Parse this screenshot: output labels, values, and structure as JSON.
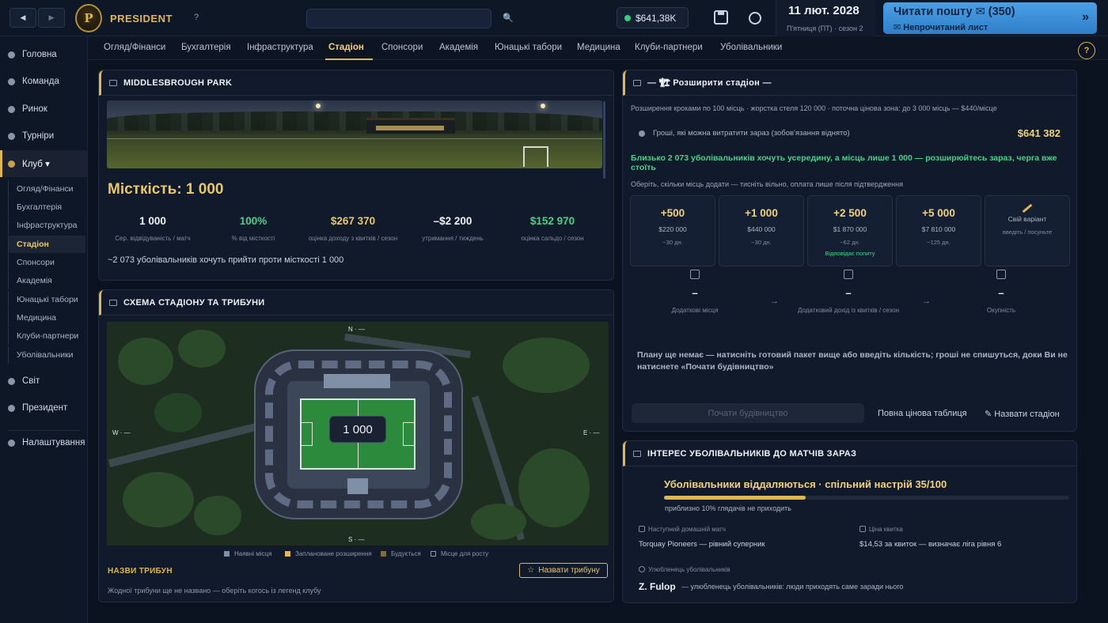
{
  "topbar": {
    "back": "◀",
    "forward": "▶",
    "logo": "P",
    "brand": "PRESIDENT",
    "help": "?",
    "search_icon": "🔍",
    "balance": "$641,38K",
    "date": "11 лют. 2028",
    "date_sub": "П'ятниця (ПТ) · сезон 2",
    "mail_main": "Читати пошту ✉ (350)",
    "mail_sub": "✉ Непрочитаний лист",
    "mail_arrow": "»"
  },
  "sidebar": {
    "items": [
      {
        "label": "Головна"
      },
      {
        "label": "Команда"
      },
      {
        "label": "Ринок"
      },
      {
        "label": "Турніри"
      },
      {
        "label": "Клуб ▾"
      },
      {
        "label": "Світ"
      },
      {
        "label": "Президент"
      },
      {
        "label": "Налаштування"
      }
    ],
    "club_sub": [
      "Огляд/Фінанси",
      "Бухгалтерія",
      "Інфраструктура",
      "Стадіон",
      "Спонсори",
      "Академія",
      "Юнацькі табори",
      "Медицина",
      "Клуби-партнери",
      "Уболівальники"
    ]
  },
  "tabs": [
    "Огляд/Фінанси",
    "Бухгалтерія",
    "Інфраструктура",
    "Стадіон",
    "Спонсори",
    "Академія",
    "Юнацькі табори",
    "Медицина",
    "Клуби-партнери",
    "Уболівальники"
  ],
  "help_circle": "?",
  "stadium": {
    "title": "MIDDLESBROUGH PARK",
    "capacity": "Місткість: 1 000",
    "stats": [
      {
        "value": "1 000",
        "label": "Сер. відвідуваність / матч"
      },
      {
        "value": "100%",
        "label": "% від місткості"
      },
      {
        "value": "$267 370",
        "label": "оцінка доходу з квитків / сезон"
      },
      {
        "value": "–$2 200",
        "label": "утримання / тиждень"
      },
      {
        "value": "$152 970",
        "label": "оцінка сальдо / сезон"
      }
    ],
    "fans_line": "~2 073 уболівальників хочуть прийти проти місткості 1 000"
  },
  "schema": {
    "title": "СХЕМА СТАДІОНУ ТА ТРИБУНИ",
    "capacity_badge": "1 000",
    "compass": {
      "n": "N · —",
      "s": "S · —",
      "w": "W · —",
      "e": "E · —"
    },
    "legend": [
      "Наявні місця",
      "Заплановане розширення",
      "Будується",
      "Місце для росту"
    ],
    "stands_title": "НАЗВИ ТРИБУН",
    "name_stand_btn": "Назвати трибуну",
    "no_stands": "Жодної трибуни ще не названо — оберіть когось із легенд клубу"
  },
  "expand": {
    "title": "— 🏗 Розширити стадіон —",
    "desc": "Розширення кроками по 100 місць · жорстка стеля 120 000 · поточна цінова зона: до 3 000 місць — $440/місце",
    "money_label": "Гроші, які можна витратити зараз (зобов'язання віднято)",
    "money_value": "$641 382",
    "green_msg": "Близько 2 073 уболівальників хочуть усередину, а місць лише 1 000 — розширюйтесь зараз, черга вже стоїть",
    "choose": "Оберіть, скільки місць додати — тисніть вільно, оплата лише після підтвердження",
    "packages": [
      {
        "title": "+500",
        "price": "$220 000",
        "days": "~30 дн.",
        "note": ""
      },
      {
        "title": "+1 000",
        "price": "$440 000",
        "days": "~30 дн.",
        "note": ""
      },
      {
        "title": "+2 500",
        "price": "$1 870 000",
        "days": "~62 дн.",
        "note": "Відповідає попиту"
      },
      {
        "title": "+5 000",
        "price": "$7 810 000",
        "days": "~125 дн.",
        "note": ""
      }
    ],
    "custom_title": "Свій варіант",
    "custom_sub": "введіть / посуньте",
    "summary": [
      {
        "value": "–",
        "label": "Додаткові місця"
      },
      {
        "value": "–",
        "label": "Додатковий дохід із квитків / сезон"
      },
      {
        "value": "–",
        "label": "Окупність"
      }
    ],
    "arrow": "→",
    "plan_msg": "Плану ще немає — натисніть готовий пакет вище або введіть кількість; гроші не спишуться, доки Ви не натиснете «Почати будівництво»",
    "build_btn": "Почати будівництво",
    "price_table": "Повна цінова таблиця",
    "name_stadium": "✎ Назвати стадіон"
  },
  "interest": {
    "title": "ІНТЕРЕС УБОЛІВАЛЬНИКІВ ДО МАТЧІВ ЗАРАЗ",
    "mood_prefix": "Уболівальники віддаляються · спільний настрій ",
    "mood_value": "35/100",
    "mood_fraction": 0.35,
    "sub": "приблизно 10% глядачів не приходить",
    "next_match_label": "Наступний домашній матч",
    "next_match_value": "Torquay Pioneers — рівний суперник",
    "ticket_label": "Ціна квитка",
    "ticket_value": "$14,53 за квиток — визначає ліга рівня 6",
    "fav_label": "Улюбленець уболівальників",
    "fav_name": "Z. Fulop",
    "fav_desc": "— улюбленець уболівальників: люди приходять саме заради нього"
  }
}
